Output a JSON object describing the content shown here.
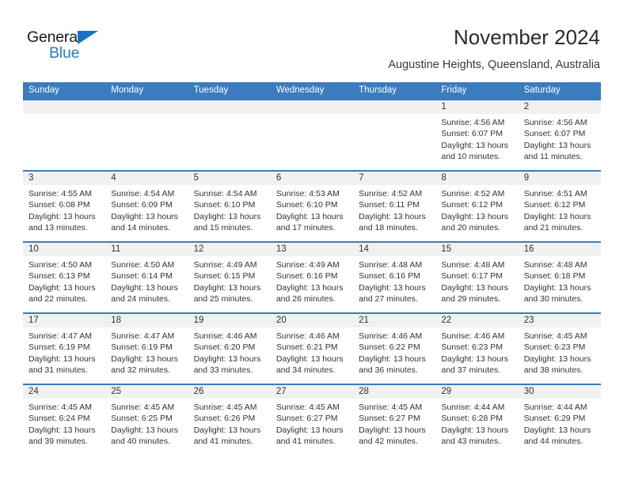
{
  "brand": {
    "name_line1": "General",
    "name_line2": "Blue",
    "triangle_color": "#1575c0",
    "blue_text_color": "#1f7dc4"
  },
  "header": {
    "title": "November 2024",
    "subtitle": "Augustine Heights, Queensland, Australia"
  },
  "colors": {
    "header_bar": "#3a7cbe",
    "date_band": "#f1f1f1",
    "week_border": "#3a7cbe",
    "text": "#333333"
  },
  "day_headers": [
    "Sunday",
    "Monday",
    "Tuesday",
    "Wednesday",
    "Thursday",
    "Friday",
    "Saturday"
  ],
  "weeks": [
    {
      "days": [
        {
          "num": "",
          "lines": [
            "",
            "",
            "",
            ""
          ]
        },
        {
          "num": "",
          "lines": [
            "",
            "",
            "",
            ""
          ]
        },
        {
          "num": "",
          "lines": [
            "",
            "",
            "",
            ""
          ]
        },
        {
          "num": "",
          "lines": [
            "",
            "",
            "",
            ""
          ]
        },
        {
          "num": "",
          "lines": [
            "",
            "",
            "",
            ""
          ]
        },
        {
          "num": "1",
          "lines": [
            "Sunrise: 4:56 AM",
            "Sunset: 6:07 PM",
            "Daylight: 13 hours",
            "and 10 minutes."
          ]
        },
        {
          "num": "2",
          "lines": [
            "Sunrise: 4:56 AM",
            "Sunset: 6:07 PM",
            "Daylight: 13 hours",
            "and 11 minutes."
          ]
        }
      ]
    },
    {
      "days": [
        {
          "num": "3",
          "lines": [
            "Sunrise: 4:55 AM",
            "Sunset: 6:08 PM",
            "Daylight: 13 hours",
            "and 13 minutes."
          ]
        },
        {
          "num": "4",
          "lines": [
            "Sunrise: 4:54 AM",
            "Sunset: 6:09 PM",
            "Daylight: 13 hours",
            "and 14 minutes."
          ]
        },
        {
          "num": "5",
          "lines": [
            "Sunrise: 4:54 AM",
            "Sunset: 6:10 PM",
            "Daylight: 13 hours",
            "and 15 minutes."
          ]
        },
        {
          "num": "6",
          "lines": [
            "Sunrise: 4:53 AM",
            "Sunset: 6:10 PM",
            "Daylight: 13 hours",
            "and 17 minutes."
          ]
        },
        {
          "num": "7",
          "lines": [
            "Sunrise: 4:52 AM",
            "Sunset: 6:11 PM",
            "Daylight: 13 hours",
            "and 18 minutes."
          ]
        },
        {
          "num": "8",
          "lines": [
            "Sunrise: 4:52 AM",
            "Sunset: 6:12 PM",
            "Daylight: 13 hours",
            "and 20 minutes."
          ]
        },
        {
          "num": "9",
          "lines": [
            "Sunrise: 4:51 AM",
            "Sunset: 6:12 PM",
            "Daylight: 13 hours",
            "and 21 minutes."
          ]
        }
      ]
    },
    {
      "days": [
        {
          "num": "10",
          "lines": [
            "Sunrise: 4:50 AM",
            "Sunset: 6:13 PM",
            "Daylight: 13 hours",
            "and 22 minutes."
          ]
        },
        {
          "num": "11",
          "lines": [
            "Sunrise: 4:50 AM",
            "Sunset: 6:14 PM",
            "Daylight: 13 hours",
            "and 24 minutes."
          ]
        },
        {
          "num": "12",
          "lines": [
            "Sunrise: 4:49 AM",
            "Sunset: 6:15 PM",
            "Daylight: 13 hours",
            "and 25 minutes."
          ]
        },
        {
          "num": "13",
          "lines": [
            "Sunrise: 4:49 AM",
            "Sunset: 6:16 PM",
            "Daylight: 13 hours",
            "and 26 minutes."
          ]
        },
        {
          "num": "14",
          "lines": [
            "Sunrise: 4:48 AM",
            "Sunset: 6:16 PM",
            "Daylight: 13 hours",
            "and 27 minutes."
          ]
        },
        {
          "num": "15",
          "lines": [
            "Sunrise: 4:48 AM",
            "Sunset: 6:17 PM",
            "Daylight: 13 hours",
            "and 29 minutes."
          ]
        },
        {
          "num": "16",
          "lines": [
            "Sunrise: 4:48 AM",
            "Sunset: 6:18 PM",
            "Daylight: 13 hours",
            "and 30 minutes."
          ]
        }
      ]
    },
    {
      "days": [
        {
          "num": "17",
          "lines": [
            "Sunrise: 4:47 AM",
            "Sunset: 6:19 PM",
            "Daylight: 13 hours",
            "and 31 minutes."
          ]
        },
        {
          "num": "18",
          "lines": [
            "Sunrise: 4:47 AM",
            "Sunset: 6:19 PM",
            "Daylight: 13 hours",
            "and 32 minutes."
          ]
        },
        {
          "num": "19",
          "lines": [
            "Sunrise: 4:46 AM",
            "Sunset: 6:20 PM",
            "Daylight: 13 hours",
            "and 33 minutes."
          ]
        },
        {
          "num": "20",
          "lines": [
            "Sunrise: 4:46 AM",
            "Sunset: 6:21 PM",
            "Daylight: 13 hours",
            "and 34 minutes."
          ]
        },
        {
          "num": "21",
          "lines": [
            "Sunrise: 4:46 AM",
            "Sunset: 6:22 PM",
            "Daylight: 13 hours",
            "and 36 minutes."
          ]
        },
        {
          "num": "22",
          "lines": [
            "Sunrise: 4:46 AM",
            "Sunset: 6:23 PM",
            "Daylight: 13 hours",
            "and 37 minutes."
          ]
        },
        {
          "num": "23",
          "lines": [
            "Sunrise: 4:45 AM",
            "Sunset: 6:23 PM",
            "Daylight: 13 hours",
            "and 38 minutes."
          ]
        }
      ]
    },
    {
      "days": [
        {
          "num": "24",
          "lines": [
            "Sunrise: 4:45 AM",
            "Sunset: 6:24 PM",
            "Daylight: 13 hours",
            "and 39 minutes."
          ]
        },
        {
          "num": "25",
          "lines": [
            "Sunrise: 4:45 AM",
            "Sunset: 6:25 PM",
            "Daylight: 13 hours",
            "and 40 minutes."
          ]
        },
        {
          "num": "26",
          "lines": [
            "Sunrise: 4:45 AM",
            "Sunset: 6:26 PM",
            "Daylight: 13 hours",
            "and 41 minutes."
          ]
        },
        {
          "num": "27",
          "lines": [
            "Sunrise: 4:45 AM",
            "Sunset: 6:27 PM",
            "Daylight: 13 hours",
            "and 41 minutes."
          ]
        },
        {
          "num": "28",
          "lines": [
            "Sunrise: 4:45 AM",
            "Sunset: 6:27 PM",
            "Daylight: 13 hours",
            "and 42 minutes."
          ]
        },
        {
          "num": "29",
          "lines": [
            "Sunrise: 4:44 AM",
            "Sunset: 6:28 PM",
            "Daylight: 13 hours",
            "and 43 minutes."
          ]
        },
        {
          "num": "30",
          "lines": [
            "Sunrise: 4:44 AM",
            "Sunset: 6:29 PM",
            "Daylight: 13 hours",
            "and 44 minutes."
          ]
        }
      ]
    }
  ]
}
